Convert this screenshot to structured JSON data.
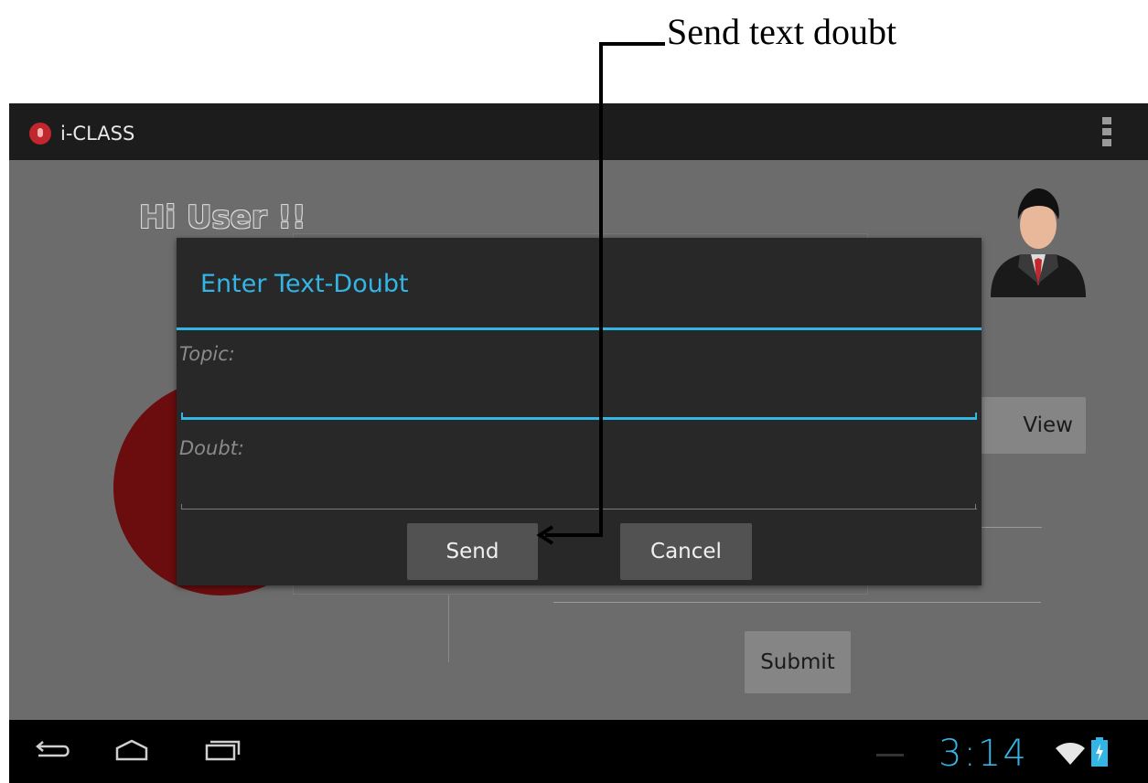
{
  "annotation": {
    "label": "Send text doubt"
  },
  "app": {
    "title": "i-CLASS",
    "icon": "microphone-icon"
  },
  "main": {
    "greeting": "Hi User !!",
    "history_button": "View History",
    "submit_button": "Submit"
  },
  "dialog": {
    "title": "Enter Text-Doubt",
    "topic_hint": "Topic:",
    "doubt_hint": "Doubt:",
    "send_label": "Send",
    "cancel_label": "Cancel"
  },
  "status": {
    "time": "3:14",
    "icons": [
      "wifi-icon",
      "battery-charging-icon"
    ]
  },
  "nav": {
    "icons": [
      "back-icon",
      "home-icon",
      "recent-apps-icon"
    ]
  },
  "colors": {
    "accent": "#33b5e5",
    "record": "#6b0c0e",
    "app_icon": "#c2272d"
  }
}
